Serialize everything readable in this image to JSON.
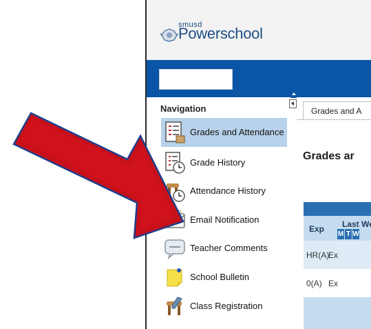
{
  "header": {
    "logo_prefix": "smusd",
    "logo_text": "Powerschool"
  },
  "navigation": {
    "title": "Navigation",
    "items": [
      {
        "label": "Grades and Attendance",
        "icon": "grades-attendance-icon",
        "active": true
      },
      {
        "label": "Grade History",
        "icon": "grade-history-icon",
        "active": false
      },
      {
        "label": "Attendance History",
        "icon": "attendance-history-icon",
        "active": false
      },
      {
        "label": "Email Notification",
        "icon": "email-notification-icon",
        "active": false
      },
      {
        "label": "Teacher Comments",
        "icon": "teacher-comments-icon",
        "active": false
      },
      {
        "label": "School Bulletin",
        "icon": "school-bulletin-icon",
        "active": false
      },
      {
        "label": "Class Registration",
        "icon": "class-registration-icon",
        "active": false
      }
    ]
  },
  "main": {
    "tab_label": "Grades and A",
    "title": "Grades ar",
    "table": {
      "col_exp": "Exp",
      "col_last_week": "Last We",
      "days": [
        "M",
        "T",
        "W"
      ],
      "rows": [
        {
          "exp": "HR(A)",
          "value": "Ex"
        },
        {
          "exp": "0(A)",
          "value": "Ex"
        }
      ]
    }
  },
  "colors": {
    "brand_blue": "#0a55a6",
    "nav_active": "#b7d2ea",
    "arrow_red": "#c8101a",
    "arrow_outline": "#1f3e8a"
  }
}
